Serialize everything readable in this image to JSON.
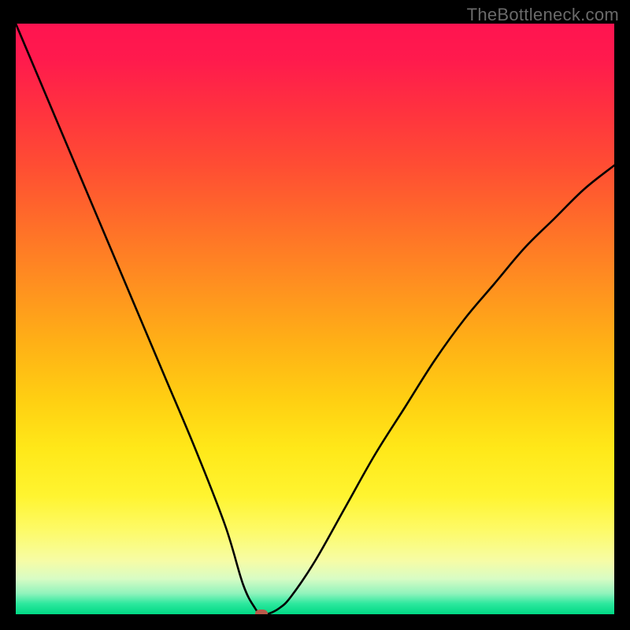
{
  "watermark": "TheBottleneck.com",
  "chart_data": {
    "type": "line",
    "title": "",
    "xlabel": "",
    "ylabel": "",
    "xlim": [
      0,
      100
    ],
    "ylim": [
      0,
      100
    ],
    "series": [
      {
        "name": "bottleneck-curve",
        "x": [
          0,
          5,
          10,
          15,
          20,
          25,
          30,
          35,
          38,
          40,
          41,
          42,
          44,
          46,
          50,
          55,
          60,
          65,
          70,
          75,
          80,
          85,
          90,
          95,
          100
        ],
        "values": [
          100,
          88,
          76,
          64,
          52,
          40,
          28,
          15,
          5,
          1,
          0,
          0,
          1,
          3,
          9,
          18,
          27,
          35,
          43,
          50,
          56,
          62,
          67,
          72,
          76
        ]
      }
    ],
    "marker": {
      "x": 41,
      "y": 0,
      "name": "optimal-point"
    },
    "gradient_stops": [
      {
        "pos": 0,
        "color": "#ff1450"
      },
      {
        "pos": 0.5,
        "color": "#ffd012"
      },
      {
        "pos": 0.86,
        "color": "#fdfb6a"
      },
      {
        "pos": 1.0,
        "color": "#00d884"
      }
    ]
  }
}
